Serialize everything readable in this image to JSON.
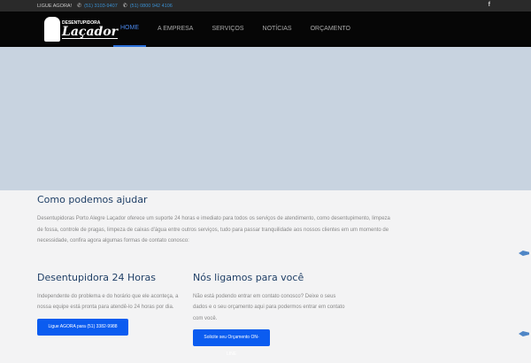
{
  "topbar": {
    "label": "LIGUE AGORA!",
    "phone1": "(51) 3103-9407",
    "phone2": "(51) 0800 942 4106",
    "social": "f"
  },
  "logo": {
    "small": "DESENTUPIDORA",
    "big": "Laçador"
  },
  "menu": [
    "HOME",
    "A EMPRESA",
    "SERVIÇOS",
    "NOTÍCIAS",
    "ORÇAMENTO"
  ],
  "main": {
    "title": "Como podemos ajudar",
    "intro": "Desentupidoras Porto Alegre Laçador oferece um suporte 24 horas e imediato para todos os serviços de atendimento, como desentupimento, limpeza de fossa, controle de pragas, limpeza de caixas d'água entre outros serviços, tudo para passar tranquilidade aos nossos clientes em um momento de necessidade, confira agora algumas formas de contato conosco:",
    "col1": {
      "title": "Desentupidora 24 Horas",
      "text": "Independente do problema e do horário que ele aconteça, a nossa equipe está pronta para atendê-lo 24 horas por dia.",
      "button": "Ligue AGORA para (51) 3382-9988"
    },
    "col2": {
      "title": "Nós ligamos para você",
      "text": "Não está podendo entrar em contato conosco? Deixe o seus dados e o seu orçamento aqui para podermos entrar em contato com você.",
      "button": "Solicite seu Orçamento ON-LINE"
    }
  }
}
